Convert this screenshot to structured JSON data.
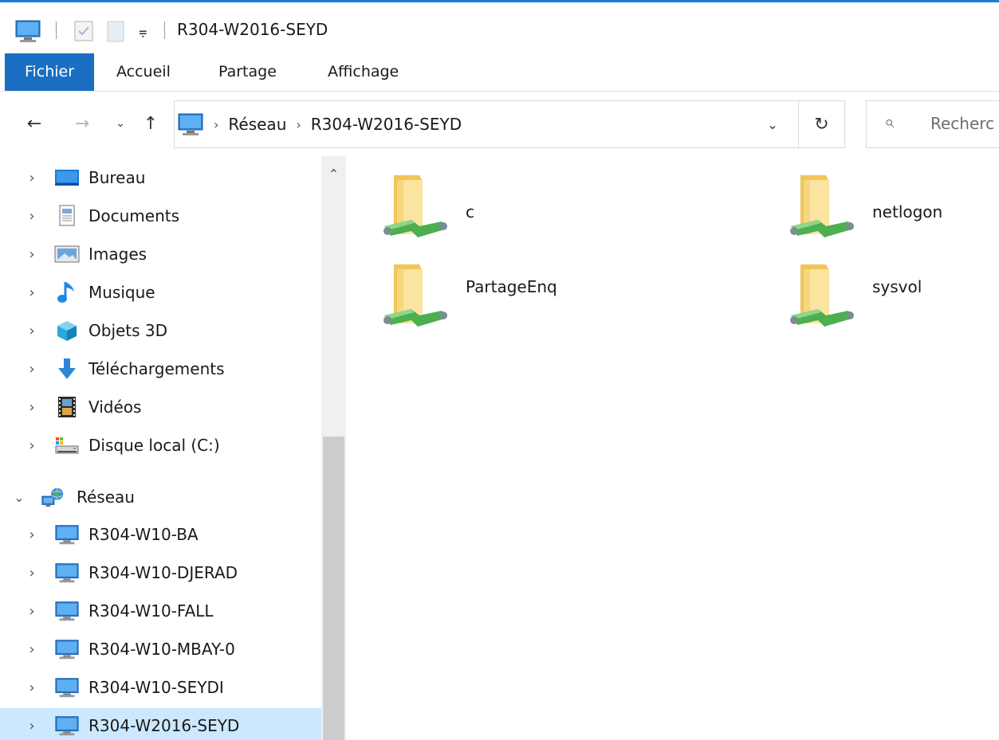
{
  "window": {
    "title": "R304-W2016-SEYD"
  },
  "ribbon": {
    "tabs": [
      {
        "label": "Fichier",
        "active": true
      },
      {
        "label": "Accueil",
        "active": false
      },
      {
        "label": "Partage",
        "active": false
      },
      {
        "label": "Affichage",
        "active": false
      }
    ]
  },
  "address_bar": {
    "breadcrumbs": [
      "Réseau",
      "R304-W2016-SEYD"
    ]
  },
  "search": {
    "placeholder": "Recherc"
  },
  "nav_pane": {
    "items": [
      {
        "label": "Bureau",
        "icon": "desktop-icon",
        "expanded": false
      },
      {
        "label": "Documents",
        "icon": "documents-icon",
        "expanded": false
      },
      {
        "label": "Images",
        "icon": "pictures-icon",
        "expanded": false
      },
      {
        "label": "Musique",
        "icon": "music-icon",
        "expanded": false
      },
      {
        "label": "Objets 3D",
        "icon": "3d-objects-icon",
        "expanded": false
      },
      {
        "label": "Téléchargements",
        "icon": "downloads-icon",
        "expanded": false
      },
      {
        "label": "Vidéos",
        "icon": "videos-icon",
        "expanded": false
      },
      {
        "label": "Disque local (C:)",
        "icon": "drive-icon",
        "expanded": false
      },
      {
        "label": "Réseau",
        "icon": "network-icon",
        "expanded": true
      },
      {
        "label": "R304-W10-BA",
        "icon": "computer-icon",
        "expanded": false
      },
      {
        "label": "R304-W10-DJERAD",
        "icon": "computer-icon",
        "expanded": false
      },
      {
        "label": "R304-W10-FALL",
        "icon": "computer-icon",
        "expanded": false
      },
      {
        "label": "R304-W10-MBAY-0",
        "icon": "computer-icon",
        "expanded": false
      },
      {
        "label": "R304-W10-SEYDI",
        "icon": "computer-icon",
        "expanded": false
      },
      {
        "label": "R304-W2016-SEYD",
        "icon": "computer-icon",
        "expanded": false,
        "selected": true
      }
    ]
  },
  "content": {
    "shares": [
      {
        "name": "c"
      },
      {
        "name": "netlogon"
      },
      {
        "name": "PartageEnq"
      },
      {
        "name": "sysvol"
      }
    ]
  },
  "colors": {
    "accent": "#1a6ec4",
    "selection": "#cce8ff",
    "folder": "#f4cf6c",
    "share_pipe": "#58b84a"
  }
}
